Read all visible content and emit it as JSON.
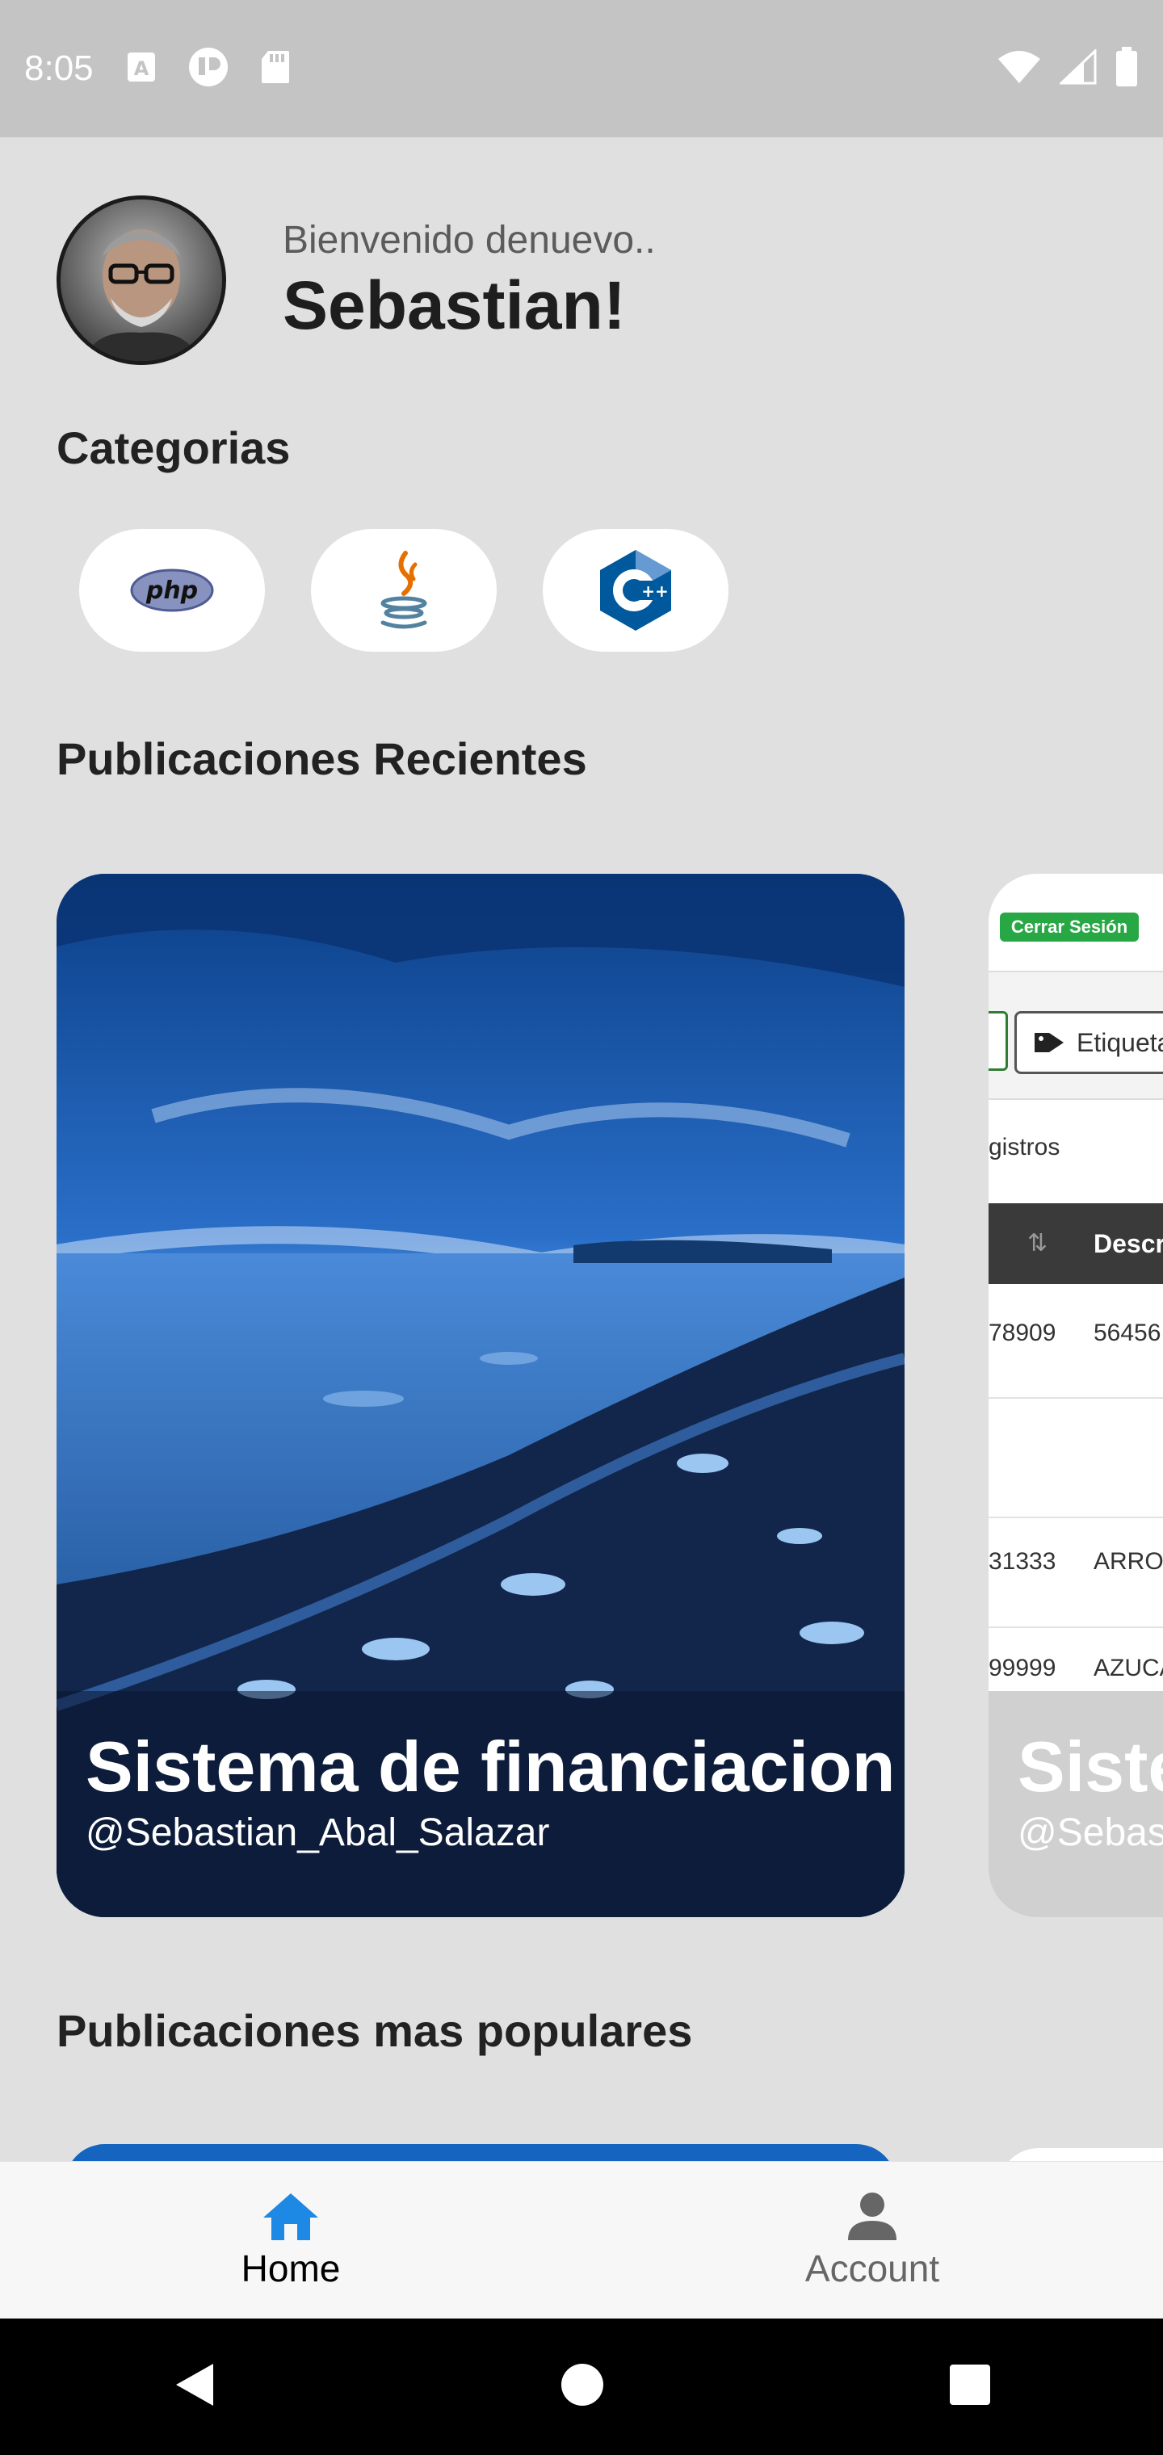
{
  "status_bar": {
    "time": "8:05"
  },
  "header": {
    "welcome": "Bienvenido denuevo..",
    "username": "Sebastian!"
  },
  "categories": {
    "title": "Categorias",
    "items": [
      {
        "name": "php",
        "label": "php"
      },
      {
        "name": "java",
        "label": ""
      },
      {
        "name": "cpp",
        "label": "++"
      }
    ]
  },
  "recent": {
    "title": "Publicaciones Recientes",
    "cards": [
      {
        "title": "Sistema de financiacion",
        "author": "@Sebastian_Abal_Salazar"
      },
      {
        "title": "Siste",
        "author": "@Sebas",
        "screenshot": {
          "logout": "Cerrar Sesión",
          "tag": "Etiqueta",
          "registros": "gistros",
          "col_header": "Descri",
          "rows": [
            {
              "code": "78909",
              "desc": "56456"
            },
            {
              "code": "31333",
              "desc": "ARROS"
            },
            {
              "code": "99999",
              "desc": "AZUCA"
            }
          ]
        }
      }
    ]
  },
  "popular": {
    "title": "Publicaciones mas populares"
  },
  "bottom_nav": {
    "items": [
      {
        "label": "Home",
        "active": true
      },
      {
        "label": "Account",
        "active": false
      }
    ]
  },
  "colors": {
    "accent": "#1e88e5",
    "background": "#e0e0e0",
    "logout_green": "#28a745"
  }
}
